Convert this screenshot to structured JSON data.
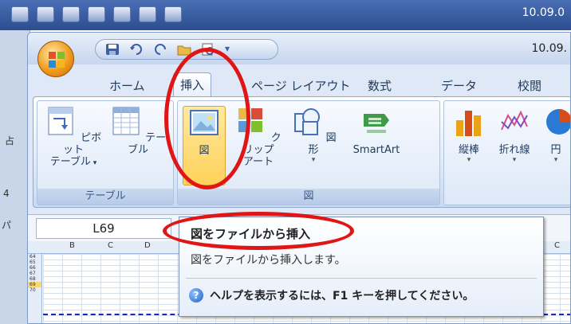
{
  "outer": {
    "date": "10.09.0"
  },
  "window": {
    "date": "10.09."
  },
  "tabs": [
    {
      "label": "ホーム"
    },
    {
      "label": "挿入",
      "active": true
    },
    {
      "label": "ページ レイアウト"
    },
    {
      "label": "数式"
    },
    {
      "label": "データ"
    },
    {
      "label": "校閲"
    }
  ],
  "groups": {
    "table": {
      "label": "テーブル",
      "pivot": {
        "line1": "ピボット",
        "line2": "テーブル"
      },
      "table_btn": "テーブル"
    },
    "illustration": {
      "label": "図",
      "picture": "図",
      "clipart": {
        "line1": "クリップ",
        "line2": "アート"
      },
      "shapes": "図形",
      "smartart": "SmartArt"
    },
    "charts": {
      "column": "縦棒",
      "line": "折れ線",
      "pie": "円"
    }
  },
  "namebox": {
    "value": "L69"
  },
  "tooltip": {
    "title": "図をファイルから挿入",
    "description": "図をファイルから挿入します。",
    "help": "ヘルプを表示するには、F1 キーを押してください。"
  },
  "sheet": {
    "col_headers": [
      "B",
      "C",
      "D",
      "C"
    ],
    "row_headers": [
      "64",
      "65",
      "66",
      "67",
      "68",
      "69",
      "70"
    ]
  },
  "outer_left": [
    "占",
    "4",
    "パ"
  ],
  "colors": {
    "annotation": "#e01515",
    "accent": "#ffd15a"
  }
}
